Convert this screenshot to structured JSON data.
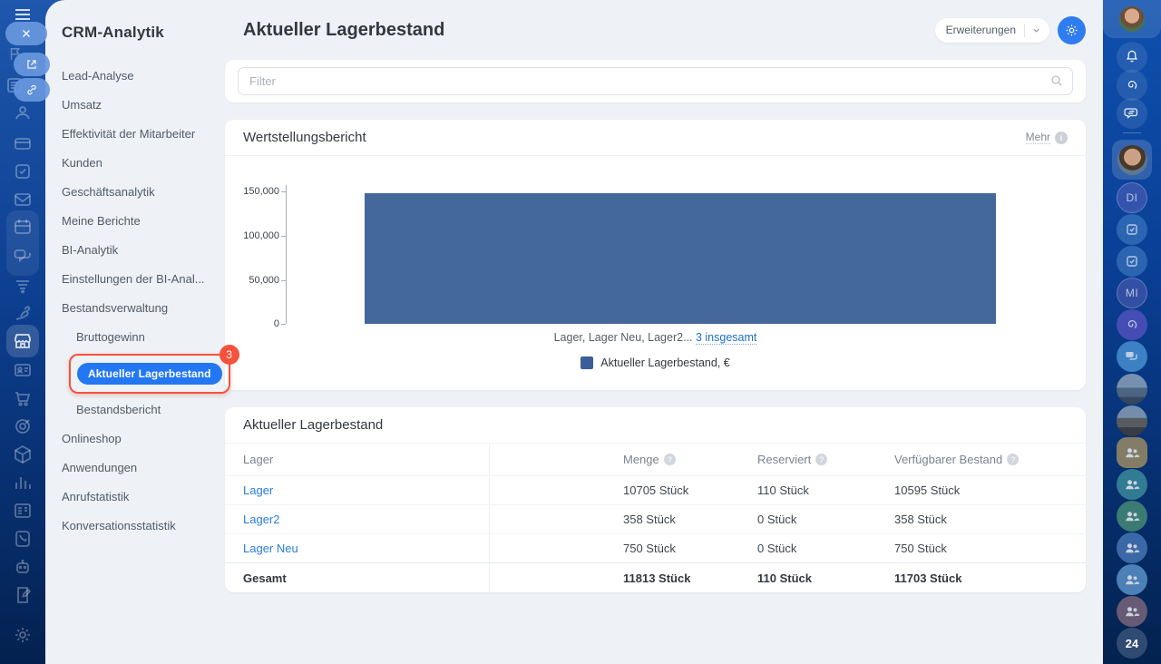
{
  "sidebar": {
    "title": "CRM-Analytik",
    "items": [
      {
        "label": "Lead-Analyse"
      },
      {
        "label": "Umsatz"
      },
      {
        "label": "Effektivität der Mitarbeiter"
      },
      {
        "label": "Kunden"
      },
      {
        "label": "Geschäftsanalytik"
      },
      {
        "label": "Meine Berichte"
      },
      {
        "label": "BI-Analytik"
      },
      {
        "label": "Einstellungen der BI-Anal..."
      },
      {
        "label": "Bestandsverwaltung"
      },
      {
        "label": "Bruttogewinn"
      },
      {
        "label": "Aktueller Lagerbestand",
        "active": true,
        "badge": "3"
      },
      {
        "label": "Bestandsbericht"
      },
      {
        "label": "Onlineshop"
      },
      {
        "label": "Anwendungen"
      },
      {
        "label": "Anrufstatistik"
      },
      {
        "label": "Konversationsstatistik"
      }
    ]
  },
  "header": {
    "title": "Aktueller Lagerbestand",
    "extensions_button": "Erweiterungen"
  },
  "filter": {
    "placeholder": "Filter"
  },
  "report_card": {
    "title": "Wertstellungsbericht",
    "more_link": "Mehr",
    "caption_text": "Lager, Lager Neu, Lager2...",
    "caption_link": "3 insgesamt",
    "legend_label": "Aktueller Lagerbestand, €"
  },
  "chart_data": {
    "type": "bar",
    "title": "Wertstellungsbericht",
    "categories": [
      "Lager, Lager Neu, Lager2 (3 insgesamt)"
    ],
    "series": [
      {
        "name": "Aktueller Lagerbestand, €",
        "values": [
          148000
        ]
      }
    ],
    "ylim": [
      0,
      150000
    ],
    "yticks": [
      "150,000",
      "100,000",
      "50,000",
      "0"
    ],
    "bar_color": "#44689c",
    "grid": false,
    "legend_position": "bottom"
  },
  "table_card": {
    "title": "Aktueller Lagerbestand",
    "columns": [
      "Lager",
      "Menge",
      "Reserviert",
      "Verfügbarer Bestand"
    ],
    "rows": [
      {
        "name": "Lager",
        "menge": "10705 Stück",
        "reserviert": "110 Stück",
        "verfuegbar": "10595 Stück"
      },
      {
        "name": "Lager2",
        "menge": "358 Stück",
        "reserviert": "0 Stück",
        "verfuegbar": "358 Stück"
      },
      {
        "name": "Lager Neu",
        "menge": "750 Stück",
        "reserviert": "0 Stück",
        "verfuegbar": "750 Stück"
      }
    ],
    "total_row": {
      "name": "Gesamt",
      "menge": "11813 Stück",
      "reserviert": "110 Stück",
      "verfuegbar": "11703 Stück"
    }
  },
  "right_rail": {
    "initials_1": "DI",
    "initials_2": "MI",
    "counter": "24"
  },
  "colors": {
    "accent_blue": "#2377f3",
    "bar_blue": "#44689c",
    "highlight_red": "#f4523c",
    "link_blue": "#2a7cdf"
  }
}
